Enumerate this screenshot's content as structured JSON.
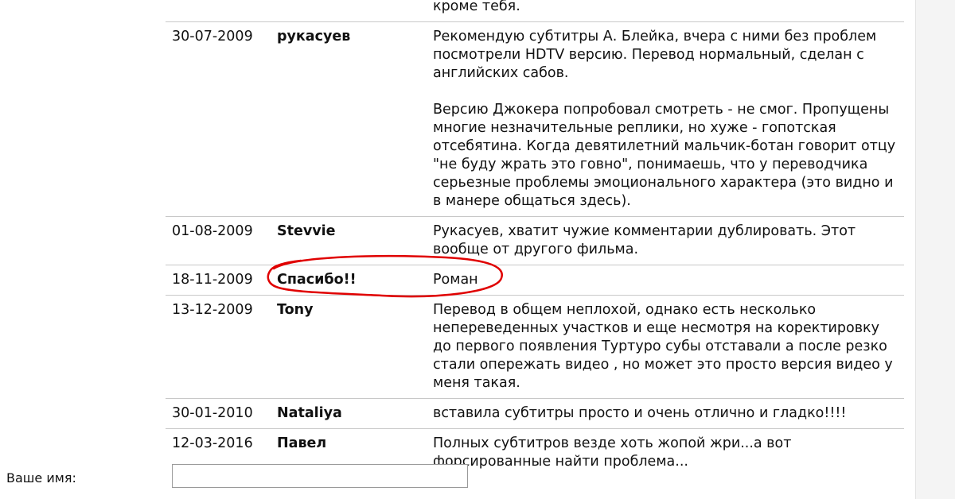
{
  "comments": [
    {
      "date": "",
      "author": "",
      "text": "кроме тебя."
    },
    {
      "date": "30-07-2009",
      "author": "рукасуев",
      "text": "Рекомендую субтитры А. Блейка, вчера с ними без проблем посмотрели HDTV версию. Перевод нормальный, сделан с английских сабов.\n\nВерсию Джокера попробовал смотреть - не смог. Пропущены многие незначительные реплики, но хуже - гопотская отсебятина. Когда девятилетний мальчик-ботан говорит отцу \"не буду жрать это говно\", понимаешь, что у переводчика серьезные проблемы эмоционального характера (это видно и в манере общаться здесь)."
    },
    {
      "date": "01-08-2009",
      "author": "Stevvie",
      "text": "Рукасуев, хватит чужие комментарии дублировать. Этот вообще от другого фильма."
    },
    {
      "date": "18-11-2009",
      "author": "Спасибо!!",
      "text": "Роман"
    },
    {
      "date": "13-12-2009",
      "author": "Tony",
      "text": "Перевод в общем неплохой, однако есть несколько непереведенных участков и еще несмотря на коректировку до первого появления Туртуро субы отставали а после резко стали опережать видео , но может это просто версия видео у меня такая."
    },
    {
      "date": "30-01-2010",
      "author": "Nataliya",
      "text": "вставила субтитры просто и очень отлично и гладко!!!!"
    },
    {
      "date": "12-03-2016",
      "author": "Павел",
      "text": "Полных субтитров везде хоть жопой жри...а вот форсированные найти проблема..."
    }
  ],
  "form": {
    "name_label": "Ваше имя:",
    "name_value": ""
  },
  "colors": {
    "highlight": "#e00000",
    "divider": "#c8c8c8",
    "text": "#111111"
  }
}
